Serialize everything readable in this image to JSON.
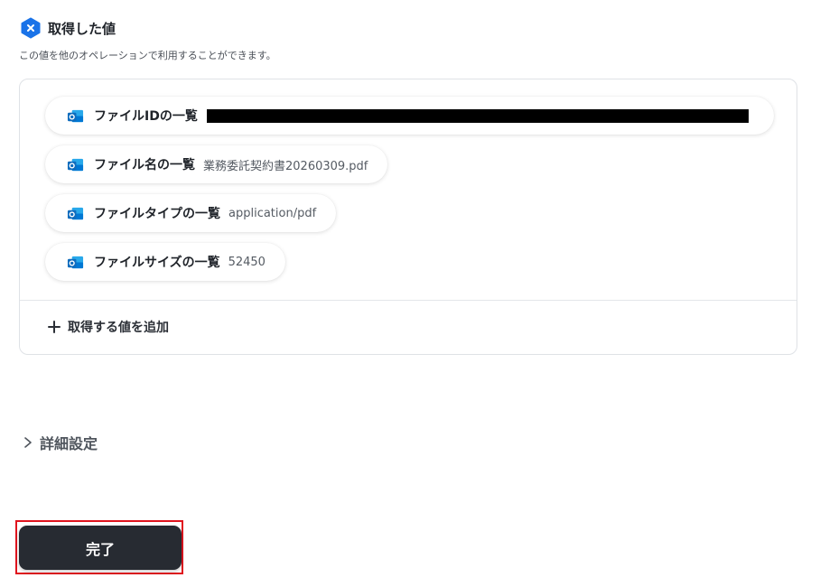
{
  "section": {
    "icon": "x-hexagon-icon",
    "title": "取得した値",
    "description": "この値を他のオペレーションで利用することができます。"
  },
  "values": [
    {
      "icon": "outlook-icon",
      "label": "ファイルIDの一覧",
      "value": "",
      "redacted": true
    },
    {
      "icon": "outlook-icon",
      "label": "ファイル名の一覧",
      "value": "業務委託契約書20260309.pdf",
      "redacted": false
    },
    {
      "icon": "outlook-icon",
      "label": "ファイルタイプの一覧",
      "value": "application/pdf",
      "redacted": false
    },
    {
      "icon": "outlook-icon",
      "label": "ファイルサイズの一覧",
      "value": "52450",
      "redacted": false
    }
  ],
  "add_value": {
    "icon": "plus-icon",
    "label": "取得する値を追加"
  },
  "advanced_settings": {
    "icon": "chevron-right-icon",
    "label": "詳細設定"
  },
  "done_button": {
    "label": "完了"
  },
  "colors": {
    "accent": "#1a73e8",
    "button": "#272b32",
    "highlight": "#e0141e",
    "outlook": "#0f6cbd"
  }
}
